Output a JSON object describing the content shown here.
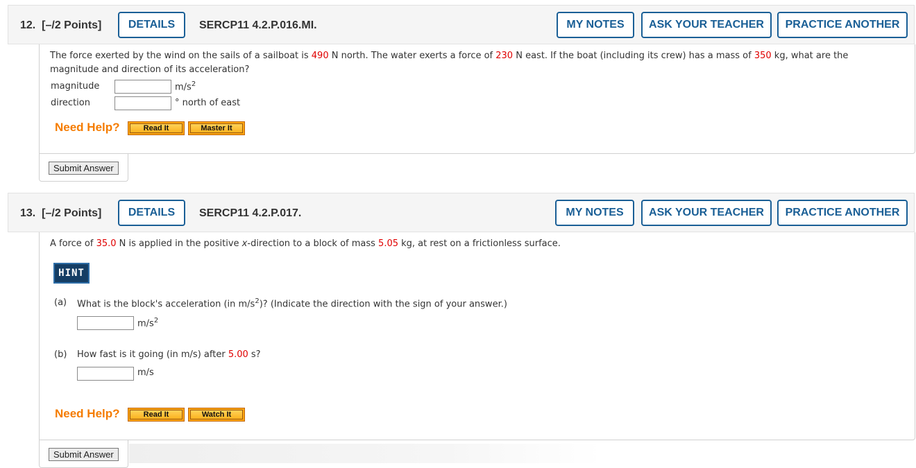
{
  "questions": [
    {
      "number": "12.",
      "points": "[–/2 Points]",
      "details_label": "DETAILS",
      "code": "SERCP11 4.2.P.016.MI.",
      "my_notes_label": "MY NOTES",
      "ask_teacher_label": "ASK YOUR TEACHER",
      "practice_another_label": "PRACTICE ANOTHER",
      "text_segments": [
        "The force exerted by the wind on the sails of a sailboat is ",
        "490",
        " N north. The water exerts a force of ",
        "230",
        " N east. If the boat (including its crew) has a mass of ",
        "350",
        " kg, what are the",
        "magnitude and direction of its acceleration?"
      ],
      "fields": [
        {
          "label": "magnitude",
          "value": "",
          "unit": "m/s",
          "unit_sup": "2"
        },
        {
          "label": "direction",
          "value": "",
          "unit": "° north of east",
          "unit_sup": ""
        }
      ],
      "need_help_label": "Need Help?",
      "help_buttons": [
        "Read It",
        "Master It"
      ],
      "submit_label": "Submit Answer"
    },
    {
      "number": "13.",
      "points": "[–/2 Points]",
      "details_label": "DETAILS",
      "code": "SERCP11 4.2.P.017.",
      "my_notes_label": "MY NOTES",
      "ask_teacher_label": "ASK YOUR TEACHER",
      "practice_another_label": "PRACTICE ANOTHER",
      "text_segments": [
        "A force of ",
        "35.0",
        " N is applied in the positive ",
        "x",
        "-direction to a block of mass ",
        "5.05",
        " kg, at rest on a frictionless surface."
      ],
      "hint_label": "HINT",
      "parts": [
        {
          "label": "(a)",
          "question_pre": "What is the block's acceleration (in m/s",
          "question_sup": "2",
          "question_post": ")? (Indicate the direction with the sign of your answer.)",
          "value": "",
          "unit": "m/s",
          "unit_sup": "2"
        },
        {
          "label": "(b)",
          "question_pre": "How fast is it going (in m/s) after ",
          "question_red": "5.00",
          "question_post": " s?",
          "value": "",
          "unit": "m/s",
          "unit_sup": ""
        }
      ],
      "need_help_label": "Need Help?",
      "help_buttons": [
        "Read It",
        "Watch It"
      ],
      "submit_label": "Submit Answer"
    }
  ],
  "colors": {
    "accent_blue": "#1a5f96",
    "given_value_red": "#e00000",
    "need_help_orange": "#f57c00",
    "hint_navy": "#143d64"
  }
}
